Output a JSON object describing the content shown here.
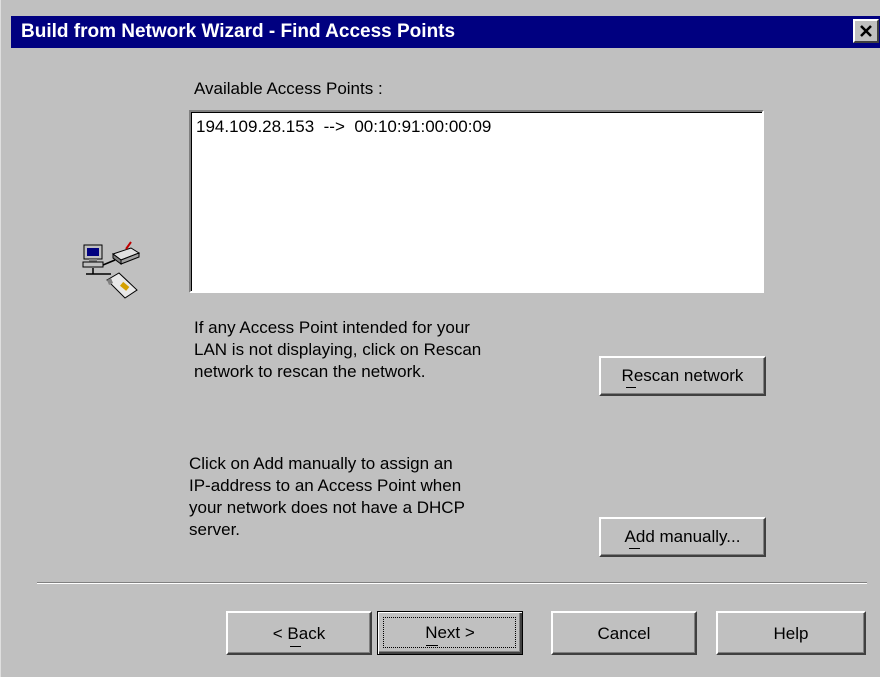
{
  "window": {
    "title": "Build from Network Wizard - Find Access Points",
    "close_glyph": "✕"
  },
  "icon": {
    "name": "network-computer-icon"
  },
  "list": {
    "label": "Available Access Points :",
    "items": [
      "194.109.28.153  -->  00:10:91:00:00:09"
    ]
  },
  "rescan": {
    "description_lines": [
      "If any Access Point intended for your",
      "LAN is not displaying, click on Rescan",
      "network to rescan the network."
    ],
    "button_label": "Rescan network",
    "accelerator": "R"
  },
  "add_manual": {
    "description_lines": [
      "Click on Add manually to assign an",
      "IP-address to an Access Point when",
      "your network does not have a DHCP",
      "server."
    ],
    "button_label": "Add manually...",
    "accelerator": "A"
  },
  "footer": {
    "back_label": "< Back",
    "next_label": "Next >",
    "cancel_label": "Cancel",
    "help_label": "Help"
  },
  "colors": {
    "titlebar": "#000080",
    "face": "#c0c0c0"
  }
}
